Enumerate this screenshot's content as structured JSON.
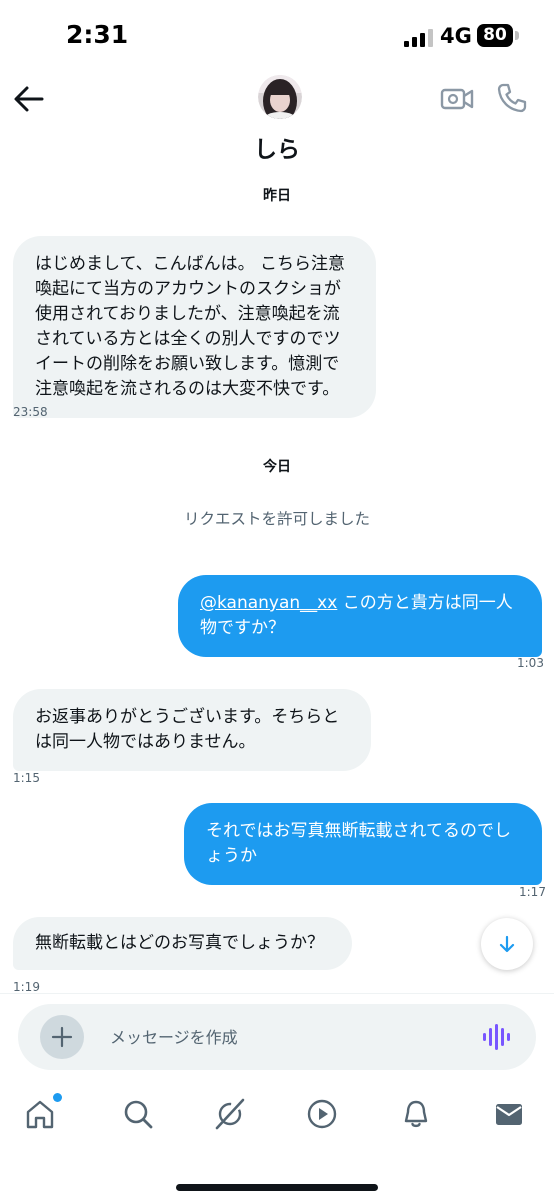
{
  "status_bar": {
    "time": "2:31",
    "network": "4G",
    "battery": "80"
  },
  "header": {
    "contact_name": "しら"
  },
  "conversation": {
    "date_yesterday": "昨日",
    "date_today": "今日",
    "system_request_accepted": "リクエストを許可しました",
    "messages": [
      {
        "direction": "incoming",
        "text": "はじめまして、こんばんは。 こちら注意喚起にて当方のアカウントのスクショが使用されておりましたが、注意喚起を流されている方とは全くの別人ですのでツイートの削除をお願い致します。憶測で注意喚起を流されるのは大変不快です。",
        "time": "23:58"
      },
      {
        "direction": "outgoing",
        "mention": "@kananyan__xx",
        "text": " この方と貴方は同一人物ですか？",
        "time": "1:03"
      },
      {
        "direction": "incoming",
        "text": "お返事ありがとうございます。そちらとは同一人物ではありません。",
        "time": "1:15"
      },
      {
        "direction": "outgoing",
        "text": "それではお写真無断転載されてるのでしょうか",
        "time": "1:17"
      },
      {
        "direction": "incoming",
        "text": "無断転載とはどのお写真でしょうか？",
        "time": "1:19"
      }
    ]
  },
  "composer": {
    "placeholder": "メッセージを作成"
  },
  "tab_bar": {
    "items": [
      {
        "name": "home",
        "icon": "home-icon",
        "has_notification_dot": true
      },
      {
        "name": "search",
        "icon": "search-icon"
      },
      {
        "name": "grok",
        "icon": "grok-icon"
      },
      {
        "name": "video",
        "icon": "play-icon"
      },
      {
        "name": "notifications",
        "icon": "bell-icon"
      },
      {
        "name": "messages",
        "icon": "mail-icon",
        "active": true
      }
    ]
  },
  "colors": {
    "accent": "#1d9bf0",
    "incoming_bubble": "#eff3f4",
    "text": "#0f1419",
    "muted": "#536471",
    "voice_icon": "#7856ff"
  }
}
